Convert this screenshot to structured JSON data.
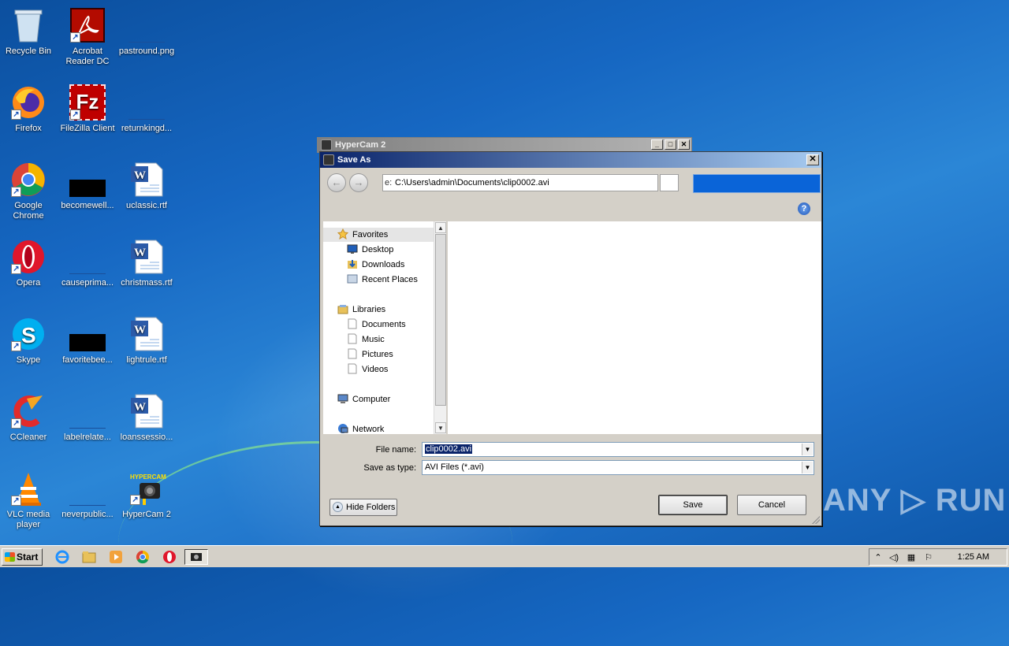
{
  "desktop": {
    "icons": [
      {
        "label": "Recycle Bin"
      },
      {
        "label": "Acrobat Reader DC"
      },
      {
        "label": "pastround.png"
      },
      {
        "label": "Firefox"
      },
      {
        "label": "FileZilla Client"
      },
      {
        "label": "returnkingd..."
      },
      {
        "label": "Google Chrome"
      },
      {
        "label": "becomewell..."
      },
      {
        "label": "uclassic.rtf"
      },
      {
        "label": "Opera"
      },
      {
        "label": "causeprima..."
      },
      {
        "label": "christmass.rtf"
      },
      {
        "label": "Skype"
      },
      {
        "label": "favoritebee..."
      },
      {
        "label": "lightrule.rtf"
      },
      {
        "label": "CCleaner"
      },
      {
        "label": "labelrelate..."
      },
      {
        "label": "loanssessio..."
      },
      {
        "label": "VLC media player"
      },
      {
        "label": "neverpublic..."
      },
      {
        "label": "HyperCam 2"
      }
    ],
    "hypercam_icon_text": "HYPERCAM"
  },
  "hypercam_window": {
    "title": "HyperCam 2"
  },
  "save_dialog": {
    "title": "Save As",
    "address_prefix": "e:",
    "address": "C:\\Users\\admin\\Documents\\clip0002.avi",
    "help_glyph": "?",
    "tree": {
      "favorites": "Favorites",
      "desktop": "Desktop",
      "downloads": "Downloads",
      "recent": "Recent Places",
      "libraries": "Libraries",
      "documents": "Documents",
      "music": "Music",
      "pictures": "Pictures",
      "videos": "Videos",
      "computer": "Computer",
      "network": "Network"
    },
    "file_name_label": "File name:",
    "file_name_value": "clip0002.avi",
    "save_type_label": "Save as type:",
    "save_type_value": "AVI Files (*.avi)",
    "hide_folders": "Hide Folders",
    "save": "Save",
    "cancel": "Cancel"
  },
  "taskbar": {
    "start": "Start",
    "clock": "1:25 AM"
  },
  "watermark": "ANY ▷ RUN",
  "colors": {
    "dialog_title": "#0a246a",
    "selection": "#0a246a",
    "desktop": "#1667c2"
  }
}
